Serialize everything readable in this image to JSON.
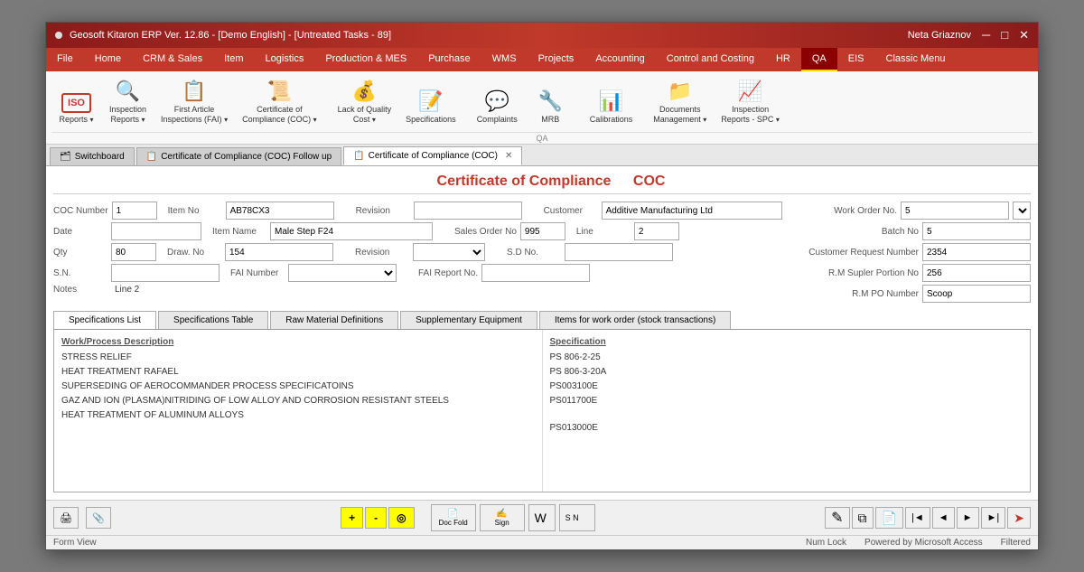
{
  "window": {
    "title": "Geosoft Kitaron ERP Ver. 12.86 - [Demo English] - [Untreated Tasks - 89]",
    "user": "Neta Griaznov",
    "dot": "•"
  },
  "menu": {
    "items": [
      "File",
      "Home",
      "CRM & Sales",
      "Item",
      "Logistics",
      "Production & MES",
      "Purchase",
      "WMS",
      "Projects",
      "Accounting",
      "Control and Costing",
      "HR",
      "QA",
      "EIS",
      "Classic Menu"
    ],
    "active": "QA"
  },
  "ribbon": {
    "label": "QA",
    "buttons": [
      {
        "icon": "📋",
        "label": "ISO\nReports ▾",
        "name": "iso-reports"
      },
      {
        "icon": "🔍",
        "label": "Inspection\nReports ▾",
        "name": "inspection-reports"
      },
      {
        "icon": "📄",
        "label": "First Article\nInspections (FAI) ▾",
        "name": "fai"
      },
      {
        "icon": "📜",
        "label": "Certificate of\nCompliance (COC) ▾",
        "name": "coc"
      },
      {
        "icon": "⚠️",
        "label": "Lack of Quality\nCost ▾",
        "name": "quality-cost"
      },
      {
        "icon": "📝",
        "label": "Specifications",
        "name": "specifications"
      },
      {
        "icon": "💬",
        "label": "Complaints",
        "name": "complaints"
      },
      {
        "icon": "🔧",
        "label": "MRB",
        "name": "mrb"
      },
      {
        "icon": "📊",
        "label": "Calibrations",
        "name": "calibrations"
      },
      {
        "icon": "📁",
        "label": "Documents\nManagement ▾",
        "name": "documents"
      },
      {
        "icon": "📈",
        "label": "Inspection\nReports - SPC ▾",
        "name": "inspection-spc"
      }
    ]
  },
  "tabs": [
    {
      "icon": "🗂",
      "label": "Switchboard",
      "name": "switchboard-tab",
      "closeable": false
    },
    {
      "icon": "📋",
      "label": "Certificate of Compliance (COC) Follow up",
      "name": "coc-followup-tab",
      "closeable": false
    },
    {
      "icon": "📋",
      "label": "Certificate of Compliance (COC)",
      "name": "coc-main-tab",
      "closeable": true,
      "active": true
    }
  ],
  "form": {
    "title": "Certificate of Compliance",
    "title_abbr": "COC",
    "fields": {
      "coc_number_label": "COC Number",
      "coc_number": "1",
      "item_no_label": "Item No",
      "item_no": "AB78CX3",
      "revision_label": "Revision",
      "customer_label": "Customer",
      "customer": "Additive Manufacturing Ltd",
      "date_label": "Date",
      "item_name_label": "Item Name",
      "item_name": "Male Step F24",
      "sales_order_label": "Sales Order No",
      "sales_order": "995",
      "line_label": "Line",
      "line": "2",
      "qty_label": "Qty",
      "qty": "80",
      "draw_no_label": "Draw. No",
      "draw_no": "154",
      "revision2_label": "Revision",
      "sd_no_label": "S.D No.",
      "sn_label": "S.N.",
      "fai_number_label": "FAI Number",
      "fai_report_label": "FAI Report No.",
      "notes_label": "Notes",
      "notes": "Line 2",
      "work_order_label": "Work Order No.",
      "work_order": "5",
      "batch_no_label": "Batch No",
      "batch_no": "5",
      "customer_request_label": "Customer Request Number",
      "customer_request": "2354",
      "rm_supplier_label": "R.M Supler Portion No",
      "rm_supplier": "256",
      "rm_po_label": "R.M PO Number",
      "rm_po": "Scoop"
    },
    "spec_tabs": [
      {
        "label": "Specifications List",
        "active": true
      },
      {
        "label": "Specifications Table",
        "active": false
      },
      {
        "label": "Raw Material Definitions",
        "active": false
      },
      {
        "label": "Supplementary Equipment",
        "active": false
      },
      {
        "label": "Items for work order (stock transactions)",
        "active": false
      }
    ],
    "spec_content": {
      "work_process_label": "Work/Process Description",
      "work_items": [
        "STRESS RELIEF",
        "HEAT TREATMENT RAFAEL",
        "SUPERSEDING OF AEROCOMMANDER PROCESS SPECIFICATOINS",
        "GAZ AND ION (PLASMA)NITRIDING OF LOW ALLOY AND CORROSION RESISTANT STEELS",
        "HEAT TREATMENT OF ALUMINUM ALLOYS"
      ],
      "specification_label": "Specification",
      "spec_items": [
        "PS 806-2-25",
        "PS 806-3-20A",
        "PS003100E",
        "PS011700E",
        "",
        "PS013000E"
      ]
    }
  },
  "footer": {
    "yellow_buttons": [
      "+",
      "-",
      "◎"
    ],
    "doc_fold_label": "Doc\nFold",
    "sign_label": "Sign",
    "status": "Form View",
    "numlock": "Num Lock",
    "powered": "Powered by Microsoft Access",
    "filtered": "Filtered"
  }
}
